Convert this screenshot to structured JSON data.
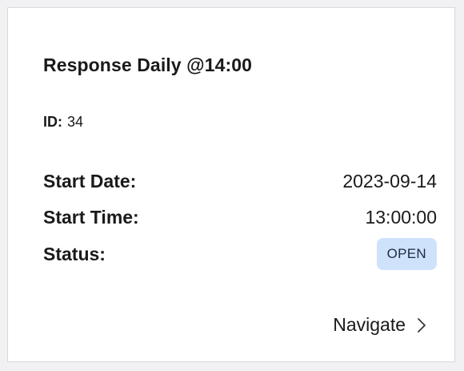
{
  "card": {
    "title": "Response Daily @14:00",
    "id_label": "ID:",
    "id_value": "34",
    "fields": {
      "start_date_label": "Start Date:",
      "start_date_value": "2023-09-14",
      "start_time_label": "Start Time:",
      "start_time_value": "13:00:00",
      "status_label": "Status:",
      "status_value": "OPEN"
    },
    "navigate_label": "Navigate",
    "navigate_icon": "chevron-right-icon"
  },
  "colors": {
    "page_background": "#f1f1f3",
    "card_background": "#ffffff",
    "status_badge_background": "#cfe2fb"
  }
}
